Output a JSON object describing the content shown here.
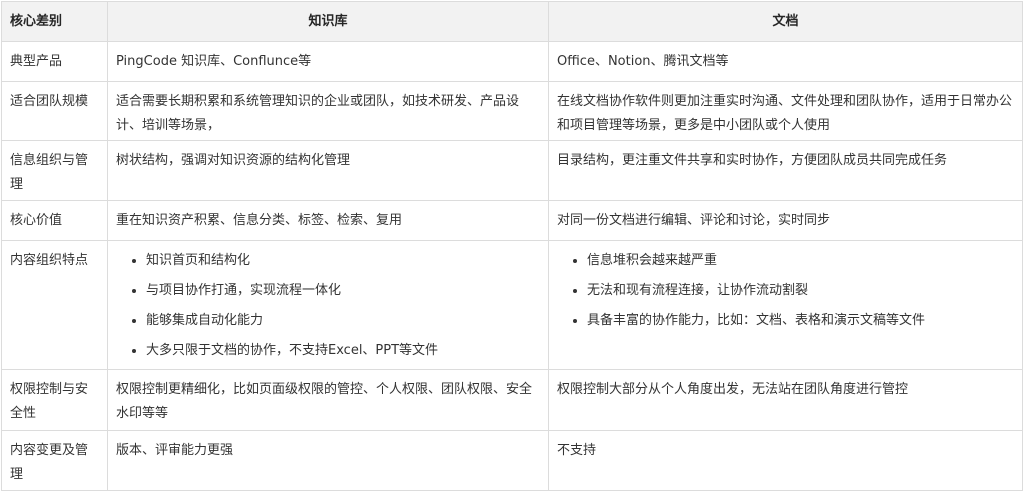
{
  "header": {
    "col1": "核心差别",
    "col2": "知识库",
    "col3": "文档"
  },
  "rows": [
    {
      "key": "典型产品",
      "kb": "PingCode 知识库、Conflunce等",
      "doc": "Office、Notion、腾讯文档等"
    },
    {
      "key": "适合团队规模",
      "kb": "适合需要长期积累和系统管理知识的企业或团队，如技术研发、产品设计、培训等场景，",
      "doc": "在线文档协作软件则更加注重实时沟通、文件处理和团队协作，适用于日常办公和项目管理等场景，更多是中小团队或个人使用"
    },
    {
      "key": "信息组织与管理",
      "kb": "树状结构，强调对知识资源的结构化管理",
      "doc": "目录结构，更注重文件共享和实时协作，方便团队成员共同完成任务"
    },
    {
      "key": "核心价值",
      "kb": "重在知识资产积累、信息分类、标签、检索、复用",
      "doc": "对同一份文档进行编辑、评论和讨论，实时同步"
    },
    {
      "key": "内容组织特点",
      "kb_items": [
        "知识首页和结构化",
        "与项目协作打通，实现流程一体化",
        "能够集成自动化能力",
        "大多只限于文档的协作，不支持Excel、PPT等文件"
      ],
      "doc_items": [
        "信息堆积会越来越严重",
        "无法和现有流程连接，让协作流动割裂",
        "具备丰富的协作能力，比如：文档、表格和演示文稿等文件"
      ]
    },
    {
      "key": "权限控制与安全性",
      "kb": "权限控制更精细化，比如页面级权限的管控、个人权限、团队权限、安全水印等等",
      "doc": "权限控制大部分从个人角度出发，无法站在团队角度进行管控"
    },
    {
      "key": "内容变更及管理",
      "kb": "版本、评审能力更强",
      "doc": "不支持"
    }
  ]
}
